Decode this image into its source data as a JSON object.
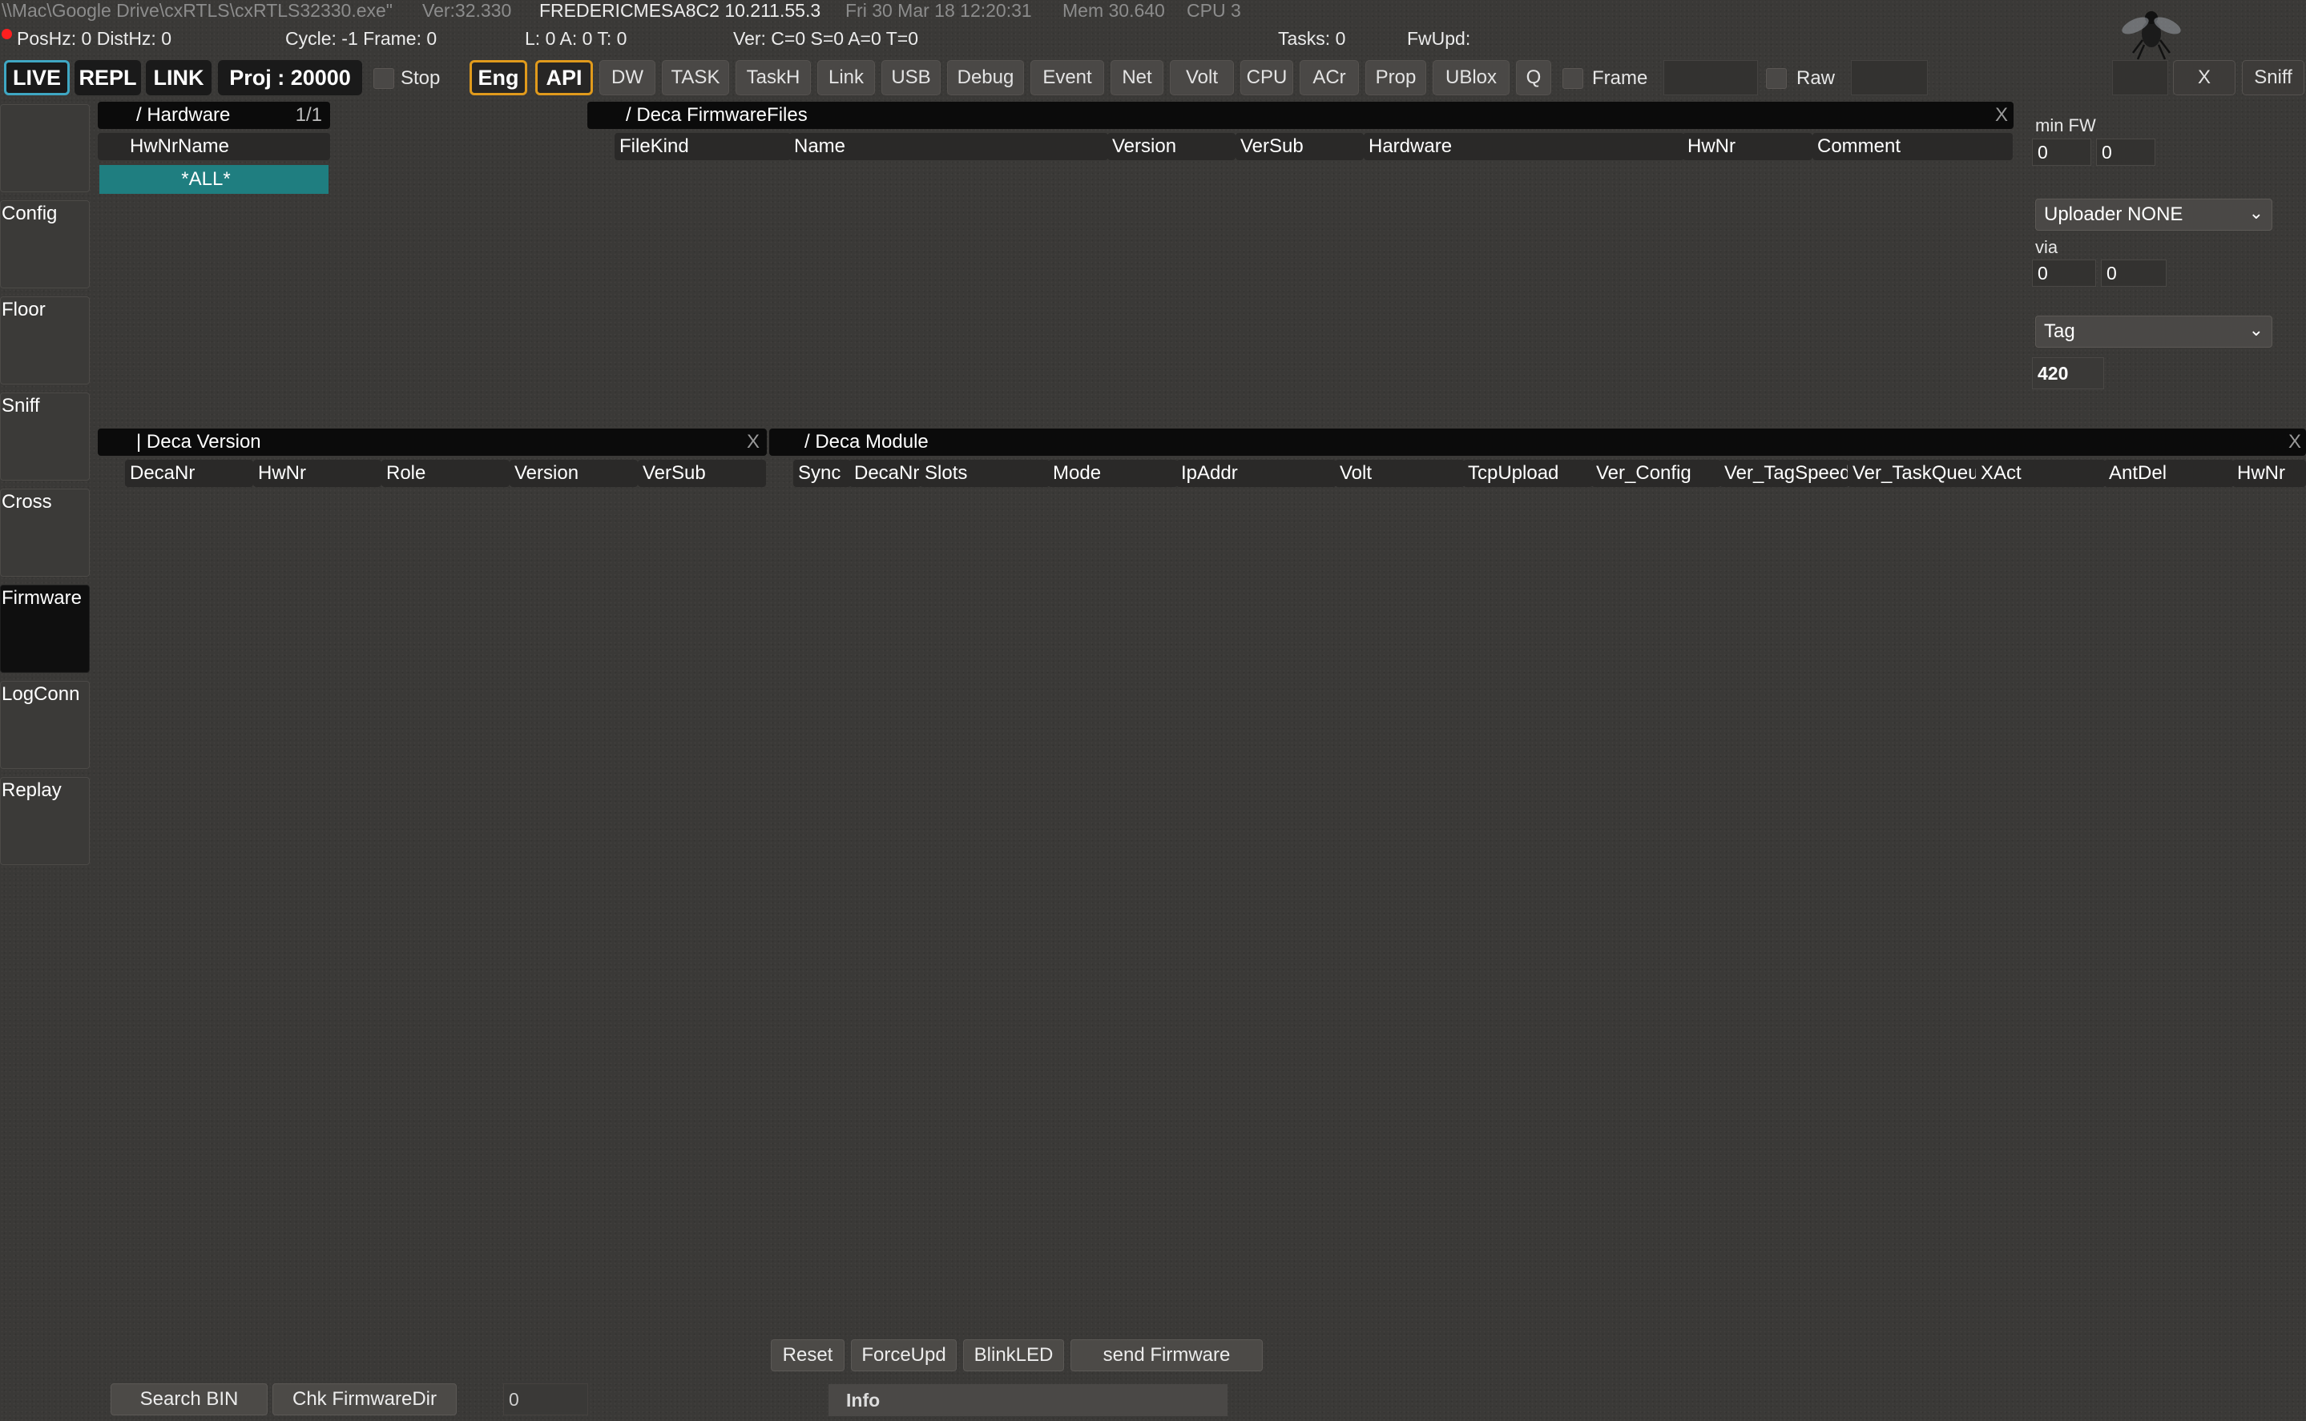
{
  "status": {
    "path": "\\\\Mac\\Google Drive\\cxRTLS\\cxRTLS32330.exe\"",
    "ver": "Ver:32.330",
    "host": "FREDERICMESA8C2 10.211.55.3",
    "date": "Fri 30 Mar 18 12:20:31",
    "mem": "Mem 30.640",
    "cpu": "CPU 3",
    "poshz": "PosHz: 0 DistHz: 0",
    "cycle": "Cycle: -1  Frame: 0",
    "lat": "L: 0  A: 0  T: 0",
    "verc": "Ver: C=0 S=0 A=0 T=0",
    "tasks": "Tasks: 0",
    "fwupd": "FwUpd:"
  },
  "toolbar": {
    "live": "LIVE",
    "repl": "REPL",
    "link": "LINK",
    "proj": "Proj : 20000",
    "stop": "Stop",
    "eng": "Eng",
    "api": "API",
    "buttons": [
      "DW",
      "TASK",
      "TaskH",
      "Link",
      "USB",
      "Debug",
      "Event",
      "Net",
      "Volt",
      "CPU",
      "ACr",
      "Prop",
      "UBlox",
      "Q"
    ],
    "frame": "Frame",
    "raw": "Raw",
    "close": "X",
    "sniff": "Sniff"
  },
  "sidebar": {
    "items": [
      "",
      "Config",
      "Floor",
      "Sniff",
      "Cross",
      "Firmware",
      "LogConn",
      "Replay"
    ],
    "active": "Firmware"
  },
  "hardware_panel": {
    "title": "/ Hardware",
    "page": "1/1",
    "columns": [
      "HwNr",
      "Name"
    ],
    "selected": "*ALL*"
  },
  "firmware_panel": {
    "title": "/ Deca FirmwareFiles",
    "close": "X",
    "columns": [
      "FileKind",
      "Name",
      "Version",
      "VerSub",
      "Hardware",
      "HwNr",
      "Comment"
    ]
  },
  "right_panel": {
    "min_fw_label": "min FW",
    "min_fw_a": "0",
    "min_fw_b": "0",
    "uploader": "Uploader NONE",
    "via_label": "via",
    "via_a": "0",
    "via_b": "0",
    "tag_select": "Tag",
    "tag_value": "420"
  },
  "version_panel": {
    "title": "| Deca Version",
    "close": "X",
    "columns": [
      "DecaNr",
      "HwNr",
      "Role",
      "Version",
      "VerSub"
    ]
  },
  "module_panel": {
    "title": "/ Deca Module",
    "close": "X",
    "columns": [
      "Sync",
      "DecaNr",
      "Slots",
      "Mode",
      "IpAddr",
      "Volt",
      "TcpUpload",
      "Ver_Config",
      "Ver_TagSpeed",
      "Ver_TaskQueue",
      "XAct",
      "AntDel",
      "HwNr"
    ]
  },
  "actions": {
    "reset": "Reset",
    "forceupd": "ForceUpd",
    "blinkled": "BlinkLED",
    "send_firmware": "send Firmware",
    "search_bin": "Search BIN",
    "chk_dir": "Chk FirmwareDir",
    "count": "0",
    "info": "Info"
  },
  "colors": {
    "accent_live": "#3fa7c3",
    "accent_orange": "#e09a1c",
    "selection_teal": "#1f7e80",
    "status_red": "#ff1f1f"
  }
}
